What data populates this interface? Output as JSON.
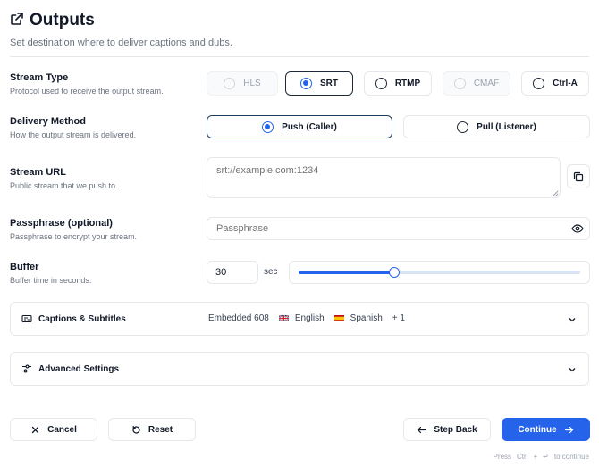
{
  "header": {
    "title": "Outputs",
    "subtitle": "Set destination where to deliver captions and dubs."
  },
  "stream_type": {
    "label": "Stream Type",
    "description": "Protocol used to receive the output stream.",
    "options": [
      {
        "label": "HLS",
        "state": "disabled"
      },
      {
        "label": "SRT",
        "state": "selected"
      },
      {
        "label": "RTMP",
        "state": "default"
      },
      {
        "label": "CMAF",
        "state": "disabled"
      },
      {
        "label": "Ctrl-A",
        "state": "default"
      }
    ]
  },
  "delivery": {
    "label": "Delivery Method",
    "description": "How the output stream is delivered.",
    "options": [
      {
        "label": "Push (Caller)",
        "state": "selected"
      },
      {
        "label": "Pull (Listener)",
        "state": "default"
      }
    ]
  },
  "stream_url": {
    "label": "Stream URL",
    "description": "Public stream that we push to.",
    "placeholder": "srt://example.com:1234"
  },
  "passphrase": {
    "label": "Passphrase (optional)",
    "description": "Passphrase to encrypt your stream.",
    "placeholder": "Passphrase"
  },
  "buffer": {
    "label": "Buffer",
    "description": "Buffer time in seconds.",
    "value": "30",
    "unit": "sec",
    "slider_fraction": 0.34
  },
  "captions": {
    "title": "Captions & Subtitles",
    "summary_format": "Embedded 608",
    "lang1": "English",
    "lang2": "Spanish",
    "more": "+ 1"
  },
  "advanced": {
    "title": "Advanced Settings"
  },
  "footer": {
    "cancel": "Cancel",
    "reset": "Reset",
    "step_back": "Step Back",
    "continue": "Continue",
    "hint_press": "Press",
    "hint_key": "Ctrl",
    "hint_plus": "+",
    "hint_enter": "↵",
    "hint_to_continue": "to continue"
  },
  "colors": {
    "accent": "#2563eb",
    "border": "#e5e7eb",
    "muted": "#6b7280"
  }
}
